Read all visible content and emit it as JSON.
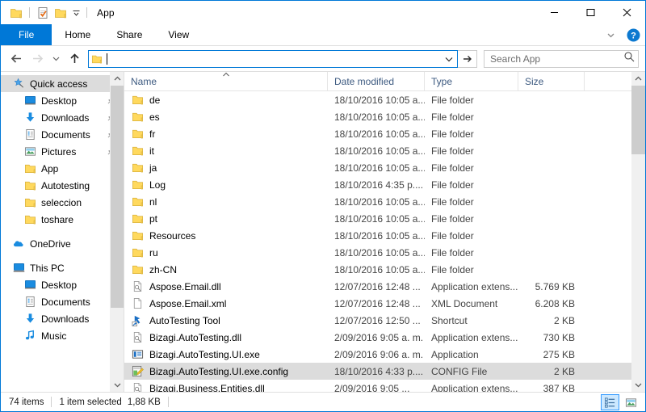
{
  "window": {
    "title": "App",
    "accent_color": "#0078d7",
    "quick_access_toolbar": [
      {
        "name": "properties-icon",
        "label": "Properties"
      },
      {
        "name": "new-folder-icon",
        "label": "New folder"
      }
    ],
    "controls": {
      "minimize": "—",
      "maximize": "□",
      "close": "✕"
    }
  },
  "ribbon": {
    "tabs": [
      {
        "id": "file",
        "label": "File"
      },
      {
        "id": "home",
        "label": "Home"
      },
      {
        "id": "share",
        "label": "Share"
      },
      {
        "id": "view",
        "label": "View"
      }
    ],
    "expand_label": "Expand the Ribbon",
    "help_label": "?"
  },
  "address_bar": {
    "back_label": "Back",
    "forward_label": "Forward",
    "recent_label": "Recent locations",
    "up_label": "Up",
    "value": "",
    "placeholder": "",
    "go_label": "Go",
    "dropdown_label": "Previous locations"
  },
  "search": {
    "placeholder": "Search App",
    "icon": "search-icon"
  },
  "sidebar": {
    "groups": [
      {
        "id": "quick-access",
        "header": {
          "label": "Quick access",
          "icon": "star-pin-icon",
          "selected": true
        },
        "items": [
          {
            "label": "Desktop",
            "icon": "desktop-icon",
            "pinned": true
          },
          {
            "label": "Downloads",
            "icon": "downloads-icon",
            "pinned": true
          },
          {
            "label": "Documents",
            "icon": "documents-icon",
            "pinned": true
          },
          {
            "label": "Pictures",
            "icon": "pictures-icon",
            "pinned": true
          },
          {
            "label": "App",
            "icon": "folder-icon",
            "pinned": false
          },
          {
            "label": "Autotesting",
            "icon": "folder-icon",
            "pinned": false
          },
          {
            "label": "seleccion",
            "icon": "folder-icon",
            "pinned": false
          },
          {
            "label": "toshare",
            "icon": "folder-icon",
            "pinned": false
          }
        ]
      },
      {
        "id": "onedrive",
        "header": {
          "label": "OneDrive",
          "icon": "onedrive-icon",
          "selected": false
        },
        "items": []
      },
      {
        "id": "this-pc",
        "header": {
          "label": "This PC",
          "icon": "thispc-icon",
          "selected": false
        },
        "items": [
          {
            "label": "Desktop",
            "icon": "desktop-icon",
            "pinned": false
          },
          {
            "label": "Documents",
            "icon": "documents-icon",
            "pinned": false
          },
          {
            "label": "Downloads",
            "icon": "downloads-icon",
            "pinned": false
          },
          {
            "label": "Music",
            "icon": "music-icon",
            "pinned": false
          }
        ]
      }
    ]
  },
  "file_list": {
    "columns": [
      {
        "id": "name",
        "label": "Name",
        "sorted": "asc"
      },
      {
        "id": "date",
        "label": "Date modified",
        "sorted": null
      },
      {
        "id": "type",
        "label": "Type",
        "sorted": null
      },
      {
        "id": "size",
        "label": "Size",
        "sorted": null
      }
    ],
    "rows": [
      {
        "name": "de",
        "date": "18/10/2016 10:05 a...",
        "type": "File folder",
        "size": "",
        "icon": "folder-icon",
        "selected": false
      },
      {
        "name": "es",
        "date": "18/10/2016 10:05 a...",
        "type": "File folder",
        "size": "",
        "icon": "folder-icon",
        "selected": false
      },
      {
        "name": "fr",
        "date": "18/10/2016 10:05 a...",
        "type": "File folder",
        "size": "",
        "icon": "folder-icon",
        "selected": false
      },
      {
        "name": "it",
        "date": "18/10/2016 10:05 a...",
        "type": "File folder",
        "size": "",
        "icon": "folder-icon",
        "selected": false
      },
      {
        "name": "ja",
        "date": "18/10/2016 10:05 a...",
        "type": "File folder",
        "size": "",
        "icon": "folder-icon",
        "selected": false
      },
      {
        "name": "Log",
        "date": "18/10/2016 4:35 p....",
        "type": "File folder",
        "size": "",
        "icon": "folder-icon",
        "selected": false
      },
      {
        "name": "nl",
        "date": "18/10/2016 10:05 a...",
        "type": "File folder",
        "size": "",
        "icon": "folder-icon",
        "selected": false
      },
      {
        "name": "pt",
        "date": "18/10/2016 10:05 a...",
        "type": "File folder",
        "size": "",
        "icon": "folder-icon",
        "selected": false
      },
      {
        "name": "Resources",
        "date": "18/10/2016 10:05 a...",
        "type": "File folder",
        "size": "",
        "icon": "folder-icon",
        "selected": false
      },
      {
        "name": "ru",
        "date": "18/10/2016 10:05 a...",
        "type": "File folder",
        "size": "",
        "icon": "folder-icon",
        "selected": false
      },
      {
        "name": "zh-CN",
        "date": "18/10/2016 10:05 a...",
        "type": "File folder",
        "size": "",
        "icon": "folder-icon",
        "selected": false
      },
      {
        "name": "Aspose.Email.dll",
        "date": "12/07/2016 12:48 ...",
        "type": "Application extens...",
        "size": "5.769 KB",
        "icon": "dll-icon",
        "selected": false
      },
      {
        "name": "Aspose.Email.xml",
        "date": "12/07/2016 12:48 ...",
        "type": "XML Document",
        "size": "6.208 KB",
        "icon": "xml-icon",
        "selected": false
      },
      {
        "name": "AutoTesting Tool",
        "date": "12/07/2016 12:50 ...",
        "type": "Shortcut",
        "size": "2 KB",
        "icon": "shortcut-icon",
        "selected": false
      },
      {
        "name": "Bizagi.AutoTesting.dll",
        "date": "2/09/2016 9:05 a. m.",
        "type": "Application extens...",
        "size": "730 KB",
        "icon": "dll-icon",
        "selected": false
      },
      {
        "name": "Bizagi.AutoTesting.UI.exe",
        "date": "2/09/2016 9:06 a. m.",
        "type": "Application",
        "size": "275 KB",
        "icon": "exe-icon",
        "selected": false
      },
      {
        "name": "Bizagi.AutoTesting.UI.exe.config",
        "date": "18/10/2016 4:33 p....",
        "type": "CONFIG File",
        "size": "2 KB",
        "icon": "config-icon",
        "selected": true
      },
      {
        "name": "Bizagi.Business.Entities.dll",
        "date": "2/09/2016 9:05 ...",
        "type": "Application extens...",
        "size": "387 KB",
        "icon": "dll-icon",
        "selected": false
      }
    ]
  },
  "status_bar": {
    "item_count": "74 items",
    "selection": "1 item selected",
    "selection_size": "1,88 KB",
    "views": [
      {
        "id": "details",
        "label": "Details view",
        "active": true
      },
      {
        "id": "large-icons",
        "label": "Large icons view",
        "active": false
      }
    ]
  }
}
